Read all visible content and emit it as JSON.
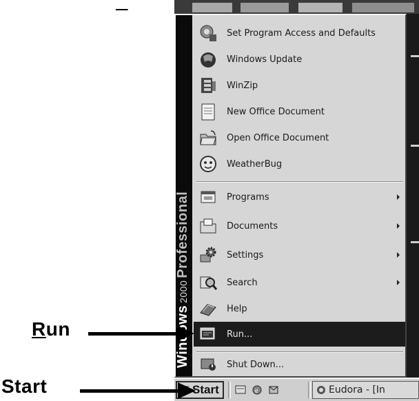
{
  "menu": {
    "banner": {
      "brand": "Windows",
      "version": "2000",
      "edition": "Professional"
    },
    "top_items": [
      {
        "label": "Set Program Access and Defaults",
        "icon": "program-access-icon"
      },
      {
        "label": "Windows Update",
        "icon": "windows-update-icon"
      },
      {
        "label": "WinZip",
        "icon": "winzip-icon"
      },
      {
        "label": "New Office Document",
        "icon": "new-office-document-icon"
      },
      {
        "label": "Open Office Document",
        "icon": "open-office-document-icon"
      },
      {
        "label": "WeatherBug",
        "icon": "weatherbug-icon"
      }
    ],
    "main_items": [
      {
        "label": "Programs",
        "icon": "programs-icon",
        "has_submenu": true
      },
      {
        "label": "Documents",
        "icon": "documents-icon",
        "has_submenu": true
      },
      {
        "label": "Settings",
        "icon": "settings-icon",
        "has_submenu": true
      },
      {
        "label": "Search",
        "icon": "search-icon",
        "has_submenu": true
      },
      {
        "label": "Help",
        "icon": "help-icon",
        "has_submenu": false
      },
      {
        "label": "Run...",
        "icon": "run-icon",
        "has_submenu": false,
        "selected": true
      }
    ],
    "bottom_items": [
      {
        "label": "Shut Down...",
        "icon": "shutdown-icon"
      }
    ]
  },
  "taskbar": {
    "start_label": "Start",
    "quick_launch": [
      "show-desktop-icon",
      "internet-explorer-icon",
      "outlook-icon"
    ],
    "task_label": "Eudora - [In"
  },
  "callouts": {
    "run_label_first": "R",
    "run_label_rest": "un",
    "start_label": "Start"
  },
  "colors": {
    "menu_bg": "#d6d6d6",
    "banner_bg": "#0a0a0a",
    "selected_bg": "#1c1c1c",
    "selected_text": "#e6e6e6"
  }
}
